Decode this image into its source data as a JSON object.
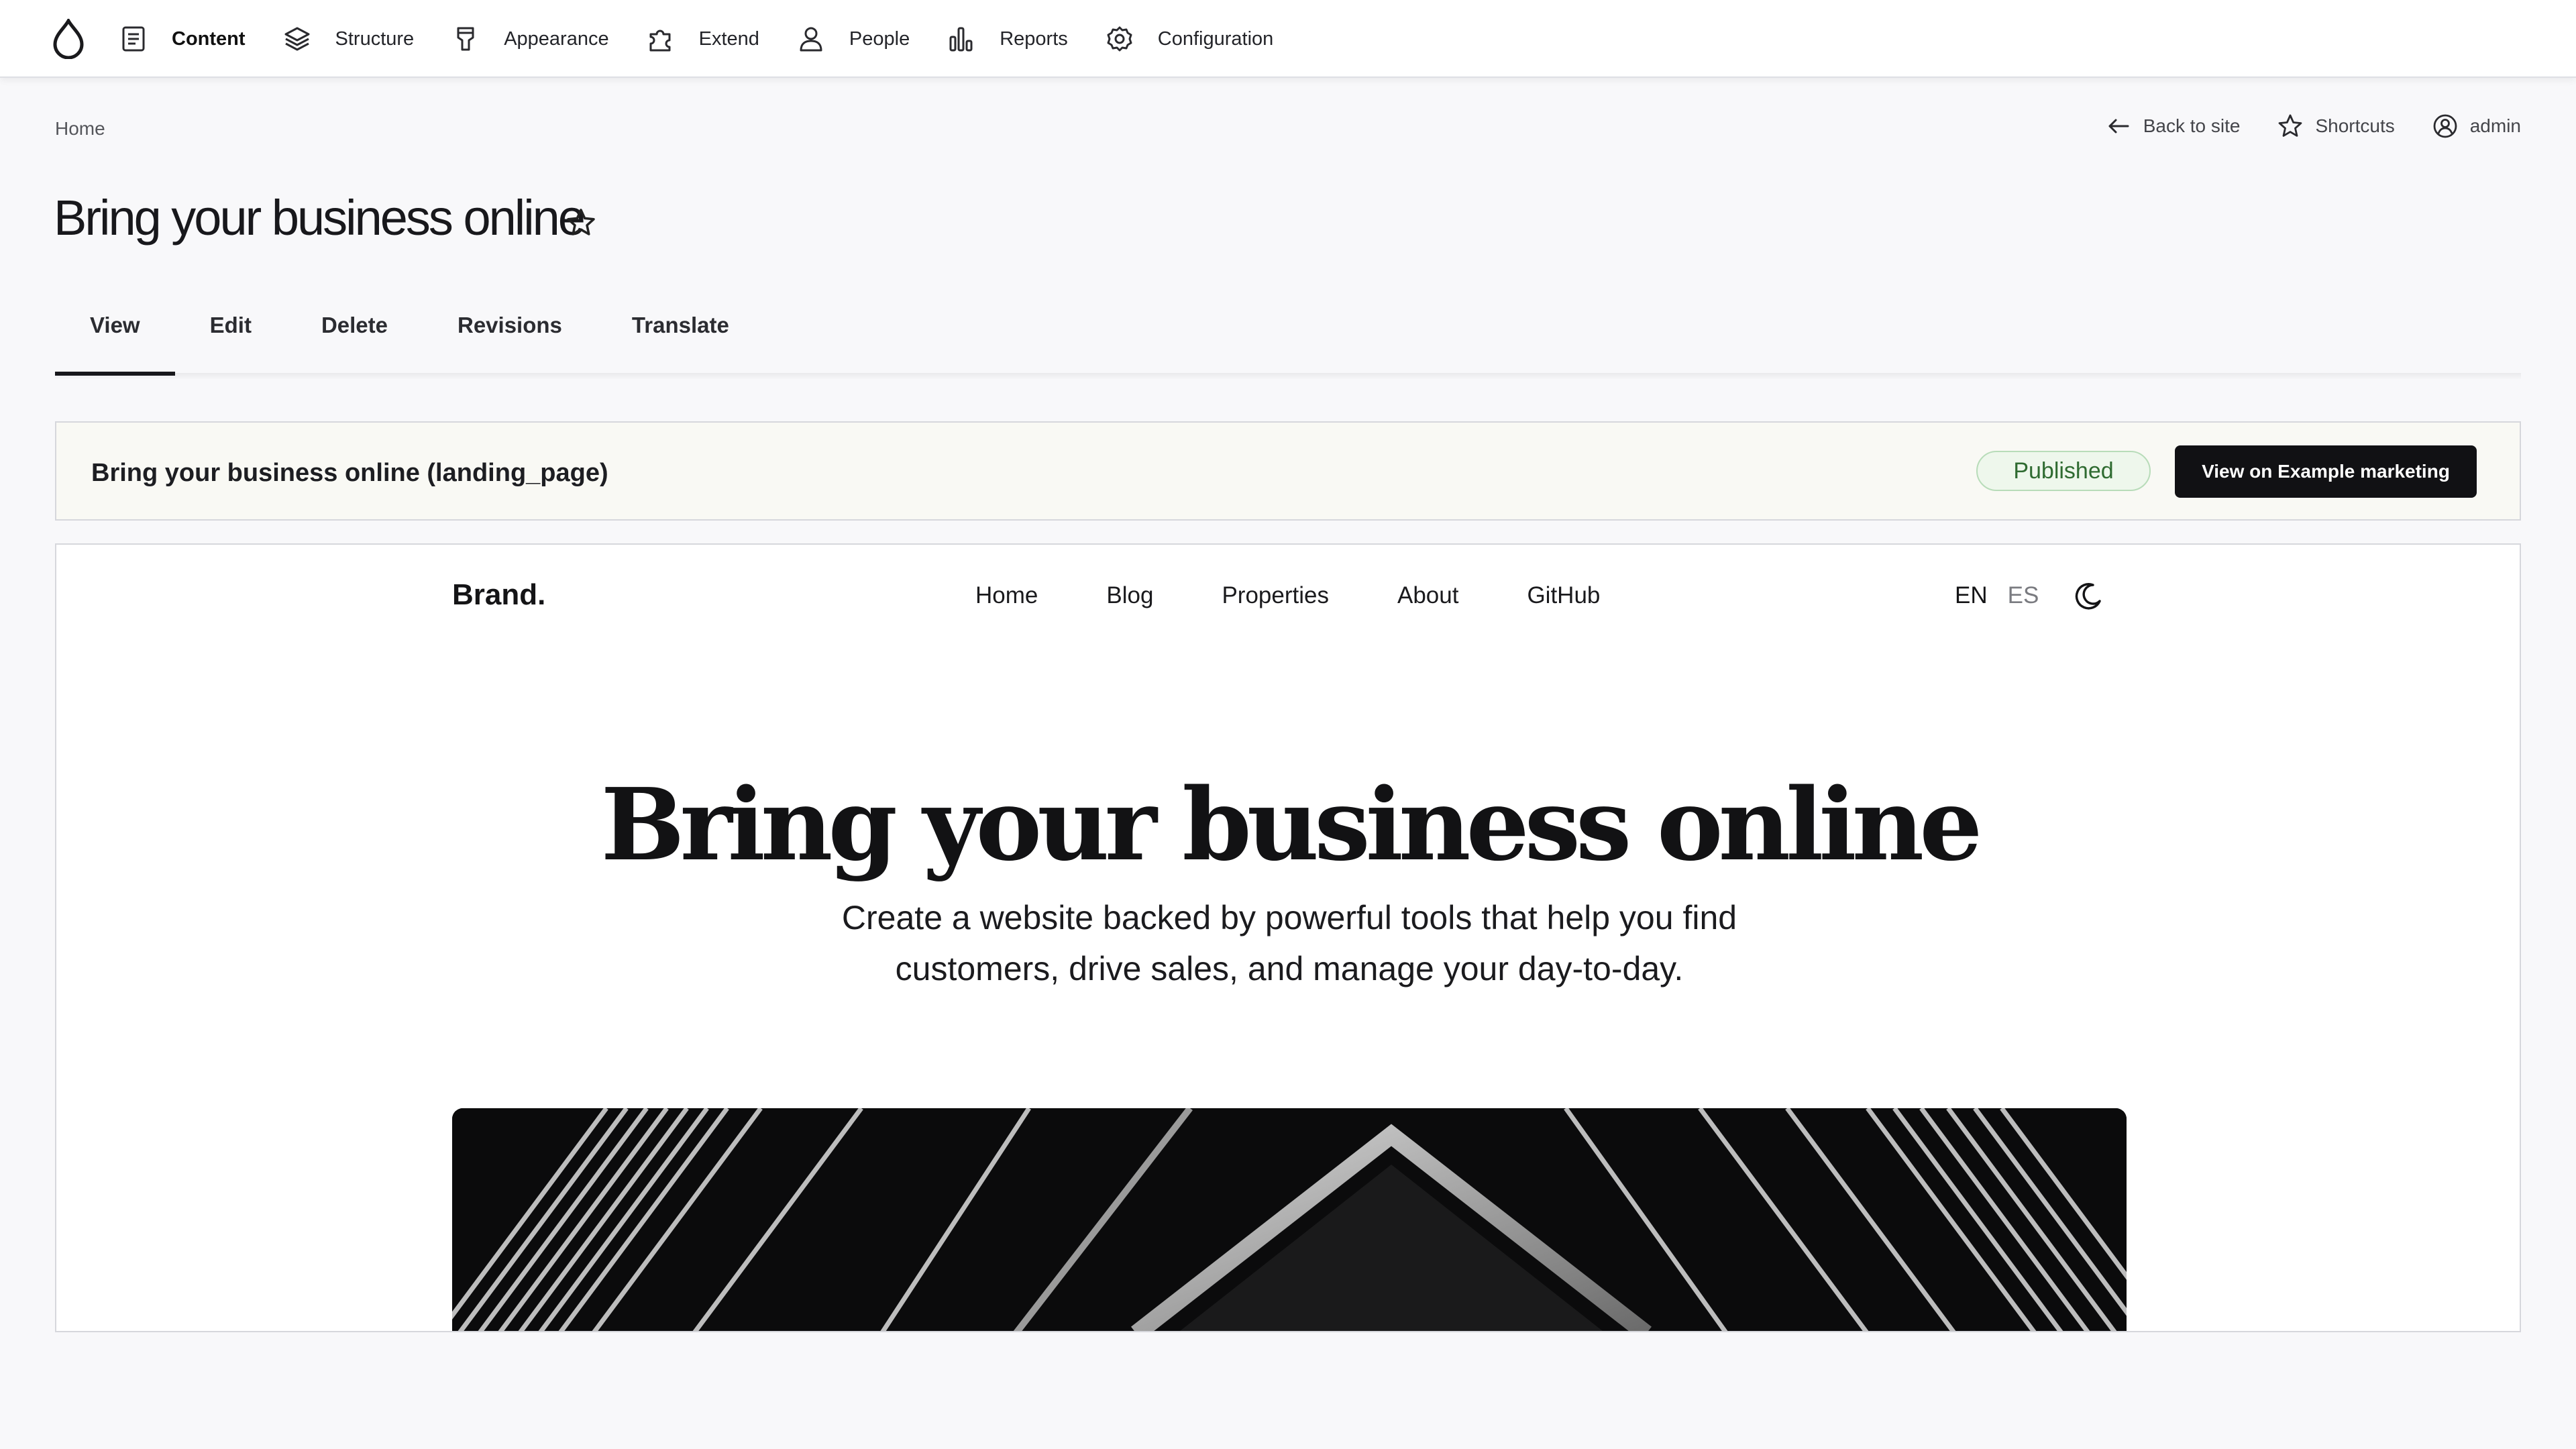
{
  "toolbar": {
    "items": [
      {
        "label": "Content",
        "icon": "document-icon",
        "active": true
      },
      {
        "label": "Structure",
        "icon": "layers-icon"
      },
      {
        "label": "Appearance",
        "icon": "paint-brush-icon"
      },
      {
        "label": "Extend",
        "icon": "puzzle-icon"
      },
      {
        "label": "People",
        "icon": "person-icon"
      },
      {
        "label": "Reports",
        "icon": "bar-chart-icon"
      },
      {
        "label": "Configuration",
        "icon": "gear-icon"
      }
    ]
  },
  "breadcrumb": {
    "home": "Home"
  },
  "header_actions": {
    "back": "Back to site",
    "shortcuts": "Shortcuts",
    "user": "admin"
  },
  "page": {
    "title": "Bring your business online"
  },
  "tabs": [
    {
      "label": "View",
      "active": true
    },
    {
      "label": "Edit"
    },
    {
      "label": "Delete"
    },
    {
      "label": "Revisions"
    },
    {
      "label": "Translate"
    }
  ],
  "info_bar": {
    "title": "Bring your business online (landing_page)",
    "status": "Published",
    "view_button": "View on Example marketing"
  },
  "preview": {
    "brand": "Brand.",
    "nav": [
      "Home",
      "Blog",
      "Properties",
      "About",
      "GitHub"
    ],
    "languages": [
      "EN",
      "ES"
    ],
    "hero_title": "Bring your business online",
    "hero_subtitle": "Create a website backed by powerful tools that help you find customers, drive sales, and manage your day-to-day."
  },
  "colors": {
    "page_bg": "#f8f8fa",
    "button_dark": "#111114",
    "published_green": "#2f6b31",
    "published_bg": "#eef7ec"
  }
}
